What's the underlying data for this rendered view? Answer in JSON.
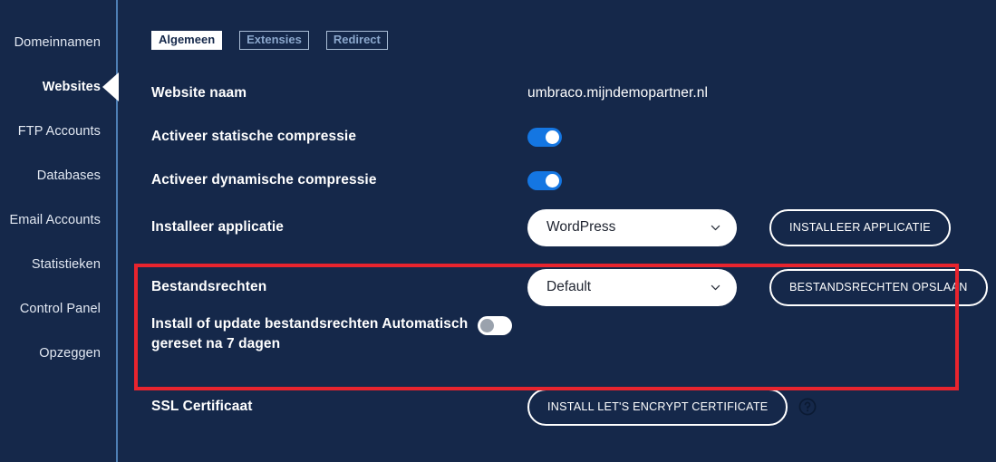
{
  "colors": {
    "background": "#15284a",
    "sidebar_divider": "#4e7fb5",
    "toggle_on": "#1476e2",
    "highlight_border": "#e8242e",
    "tab_active_bg": "#ffffff",
    "tab_inactive_text": "#8ba7cc",
    "text": "#ffffff"
  },
  "sidebar": {
    "items": [
      {
        "label": "Domeinnamen",
        "active": false
      },
      {
        "label": "Websites",
        "active": true
      },
      {
        "label": "FTP Accounts",
        "active": false
      },
      {
        "label": "Databases",
        "active": false
      },
      {
        "label": "Email Accounts",
        "active": false
      },
      {
        "label": "Statistieken",
        "active": false
      },
      {
        "label": "Control Panel",
        "active": false
      },
      {
        "label": "Opzeggen",
        "active": false
      }
    ]
  },
  "tabs": [
    {
      "label": "Algemeen",
      "active": true
    },
    {
      "label": "Extensies",
      "active": false
    },
    {
      "label": "Redirect",
      "active": false
    }
  ],
  "form": {
    "website_naam": {
      "label": "Website naam",
      "value": "umbraco.mijndemopartner.nl"
    },
    "statische_compressie": {
      "label": "Activeer statische compressie",
      "toggle_state": "on"
    },
    "dynamische_compressie": {
      "label": "Activeer dynamische compressie",
      "toggle_state": "on"
    },
    "installeer_applicatie": {
      "label": "Installeer applicatie",
      "selected": "WordPress",
      "button": "INSTALLEER APPLICATIE"
    },
    "bestandsrechten": {
      "label": "Bestandsrechten",
      "selected": "Default",
      "button": "BESTANDSRECHTEN OPSLAAN"
    },
    "auto_reset": {
      "label": "Install of update bestandsrechten Automatisch gereset na 7 dagen",
      "toggle_state": "off"
    },
    "ssl": {
      "label": "SSL Certificaat",
      "button": "INSTALL LET'S ENCRYPT CERTIFICATE",
      "help_icon": "question-mark-circle-icon"
    }
  }
}
